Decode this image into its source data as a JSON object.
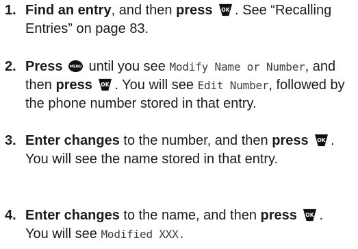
{
  "steps": [
    {
      "number": "1.",
      "bold1": "Find an entry",
      "t1": ", and then ",
      "bold2": "press",
      "t2": ". See “Recalling Entries” on page 83."
    },
    {
      "number": "2.",
      "bold1": "Press",
      "t1": " until you see ",
      "mono1": "Modify Name or Number",
      "t2": ", and then ",
      "bold2": "press",
      "t3": ". You will see ",
      "mono2": "Edit Number",
      "t4": ", followed by the phone number stored in that entry."
    },
    {
      "number": "3.",
      "bold1": "Enter changes",
      "t1": " to the number, and then ",
      "bold2": "press",
      "t2": ". You will see the name stored in that entry."
    },
    {
      "number": "4.",
      "bold1": "Enter changes",
      "t1": " to the name, and then ",
      "bold2": "press",
      "t2": ". You will see ",
      "mono1": "Modified XXX."
    }
  ],
  "icons": {
    "ok_key": "ok-key-icon",
    "ok_key_label": "OK",
    "menu_key": "menu-key-icon",
    "menu_key_label": "MENU"
  }
}
